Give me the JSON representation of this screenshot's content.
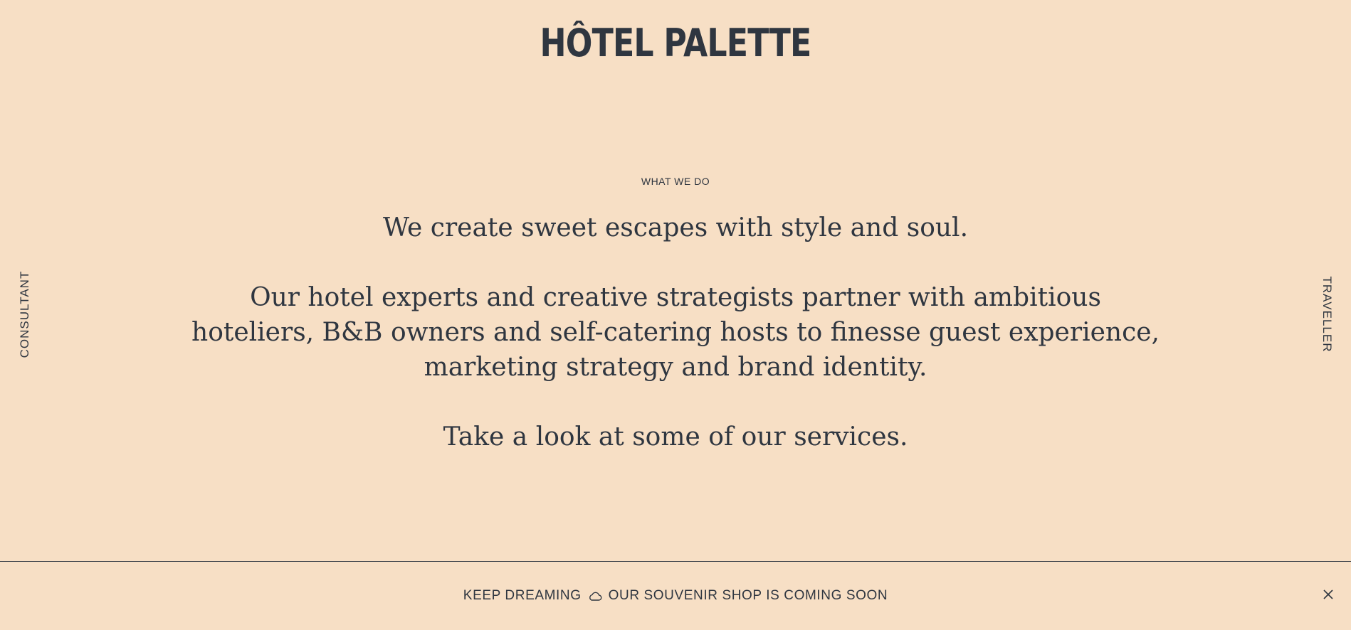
{
  "brand": {
    "logo_text": "HÔTEL PALETTE"
  },
  "side_nav": {
    "left_label": "CONSULTANT",
    "right_label": "TRAVELLER"
  },
  "what_we_do": {
    "label": "WHAT WE DO",
    "headline": "We create sweet escapes with style and soul.",
    "body": "Our hotel experts and creative strategists partner with ambitious hoteliers, B&B owners and self-catering hosts to finesse guest experience, marketing strategy and brand identity.",
    "cta": "Take a look at some of our services."
  },
  "announcement": {
    "text_before": "KEEP DREAMING",
    "text_after": "OUR SOUVENIR SHOP IS COMING SOON",
    "icon": "cloud-icon",
    "close_icon": "close-icon"
  },
  "colors": {
    "background": "#f7dfc5",
    "text": "#2f3640"
  }
}
